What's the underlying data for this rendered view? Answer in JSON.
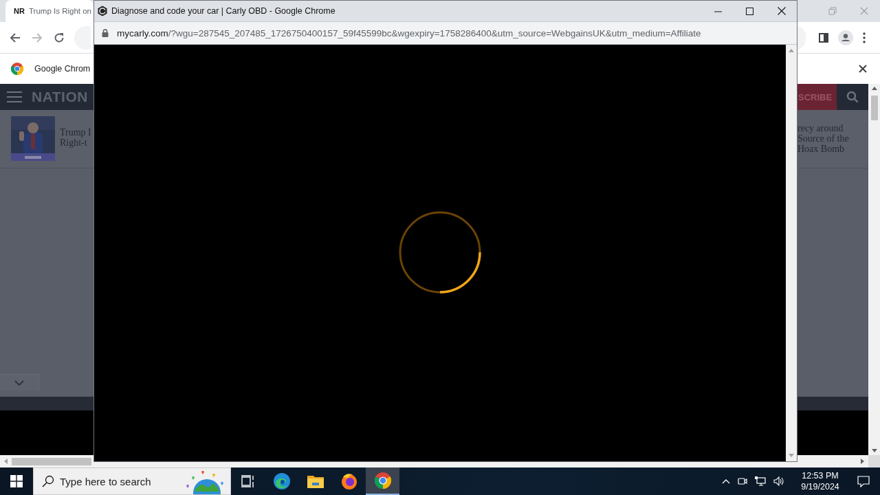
{
  "browser": {
    "tab": {
      "site_badge": "NR",
      "title": "Trump Is Right on"
    },
    "infobar": {
      "text": "Google Chrom"
    },
    "site": {
      "logo": "NATION",
      "subscribe_button": "SCRIBE",
      "left_headline": [
        "Trump I",
        "Right-t"
      ],
      "right_headline": [
        "recy around",
        "Source of the",
        "Hoax Bomb"
      ]
    }
  },
  "popup": {
    "title": "Diagnose and code your car | Carly OBD - Google Chrome",
    "url_host": "mycarly.com",
    "url_rest": "/?wgu=287545_207485_1726750400157_59f45599bc&wgexpiry=1758286400&utm_source=WebgainsUK&utm_medium=Affiliate"
  },
  "taskbar": {
    "search_placeholder": "Type here to search",
    "apps": [
      {
        "kind": "task-view",
        "selected": false
      },
      {
        "kind": "edge",
        "selected": false
      },
      {
        "kind": "files",
        "selected": false
      },
      {
        "kind": "firefox",
        "selected": false
      },
      {
        "kind": "chrome",
        "selected": true
      }
    ],
    "time": "12:53 PM",
    "date": "9/19/2024"
  }
}
